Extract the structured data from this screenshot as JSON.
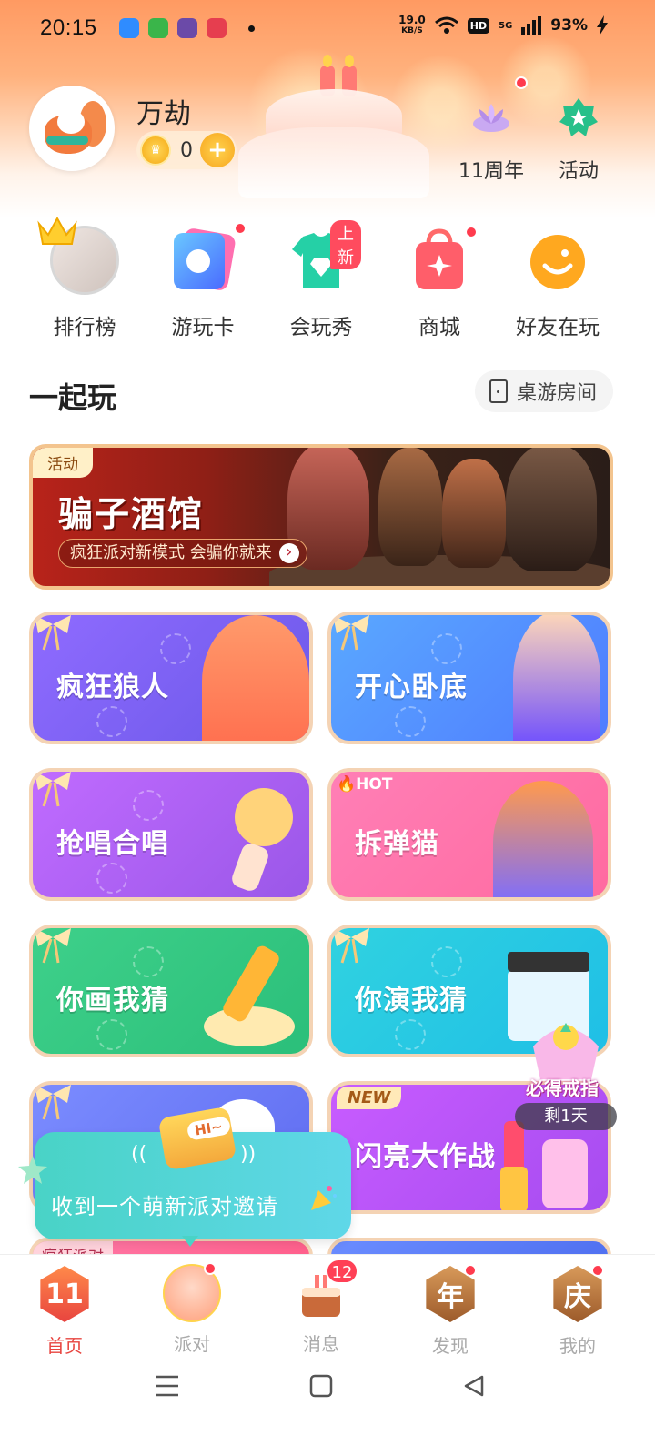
{
  "status_bar": {
    "time": "20:15",
    "net_speed_top": "19.0",
    "net_speed_bottom": "KB/S",
    "hd": "HD",
    "signal": "5G",
    "battery": "93%"
  },
  "profile": {
    "username": "万劫",
    "coins": "0",
    "actions": [
      {
        "label": "11周年",
        "icon": "anniversary-lotus-icon"
      },
      {
        "label": "活动",
        "icon": "star-badge-icon"
      }
    ]
  },
  "quick_menu": [
    {
      "label": "排行榜",
      "icon": "ranking-avatar-icon"
    },
    {
      "label": "游玩卡",
      "icon": "play-card-icon"
    },
    {
      "label": "会玩秀",
      "icon": "tshirt-gem-icon",
      "badge": "上新"
    },
    {
      "label": "商城",
      "icon": "shopping-bag-icon"
    },
    {
      "label": "好友在玩",
      "icon": "smiley-face-icon"
    }
  ],
  "section": {
    "title": "一起玩",
    "room_button": "桌游房间"
  },
  "banner": {
    "tag": "活动",
    "title": "骗子酒馆",
    "subtitle": "疯狂派对新模式 会骗你就来"
  },
  "games": [
    {
      "name": "疯狂狼人"
    },
    {
      "name": "开心卧底"
    },
    {
      "name": "抢唱合唱"
    },
    {
      "name": "拆弹猫",
      "tag": "HOT"
    },
    {
      "name": "你画我猜"
    },
    {
      "name": "你演我猜"
    },
    {
      "name": ""
    },
    {
      "name": "闪亮大作战",
      "tag": "NEW"
    },
    {
      "name": "",
      "tag": "疯狂派对"
    },
    {
      "name": ""
    }
  ],
  "invite": {
    "badge": "HI~",
    "text": "收到一个萌新派对邀请"
  },
  "ring_promo": {
    "title": "必得戒指",
    "remaining": "剩1天"
  },
  "bottom_nav": [
    {
      "label": "首页",
      "icon": "home-11-icon",
      "glyph": "11",
      "active": true
    },
    {
      "label": "派对",
      "icon": "party-avatar-icon"
    },
    {
      "label": "消息",
      "icon": "message-cake-icon",
      "count": "12"
    },
    {
      "label": "发现",
      "icon": "discover-year-icon",
      "glyph": "年"
    },
    {
      "label": "我的",
      "icon": "mine-celebrate-icon",
      "glyph": "庆"
    }
  ],
  "colors": {
    "accent": "#e8443f",
    "badge_red": "#ff3b4e",
    "hero_orange": "#ff9a62"
  }
}
